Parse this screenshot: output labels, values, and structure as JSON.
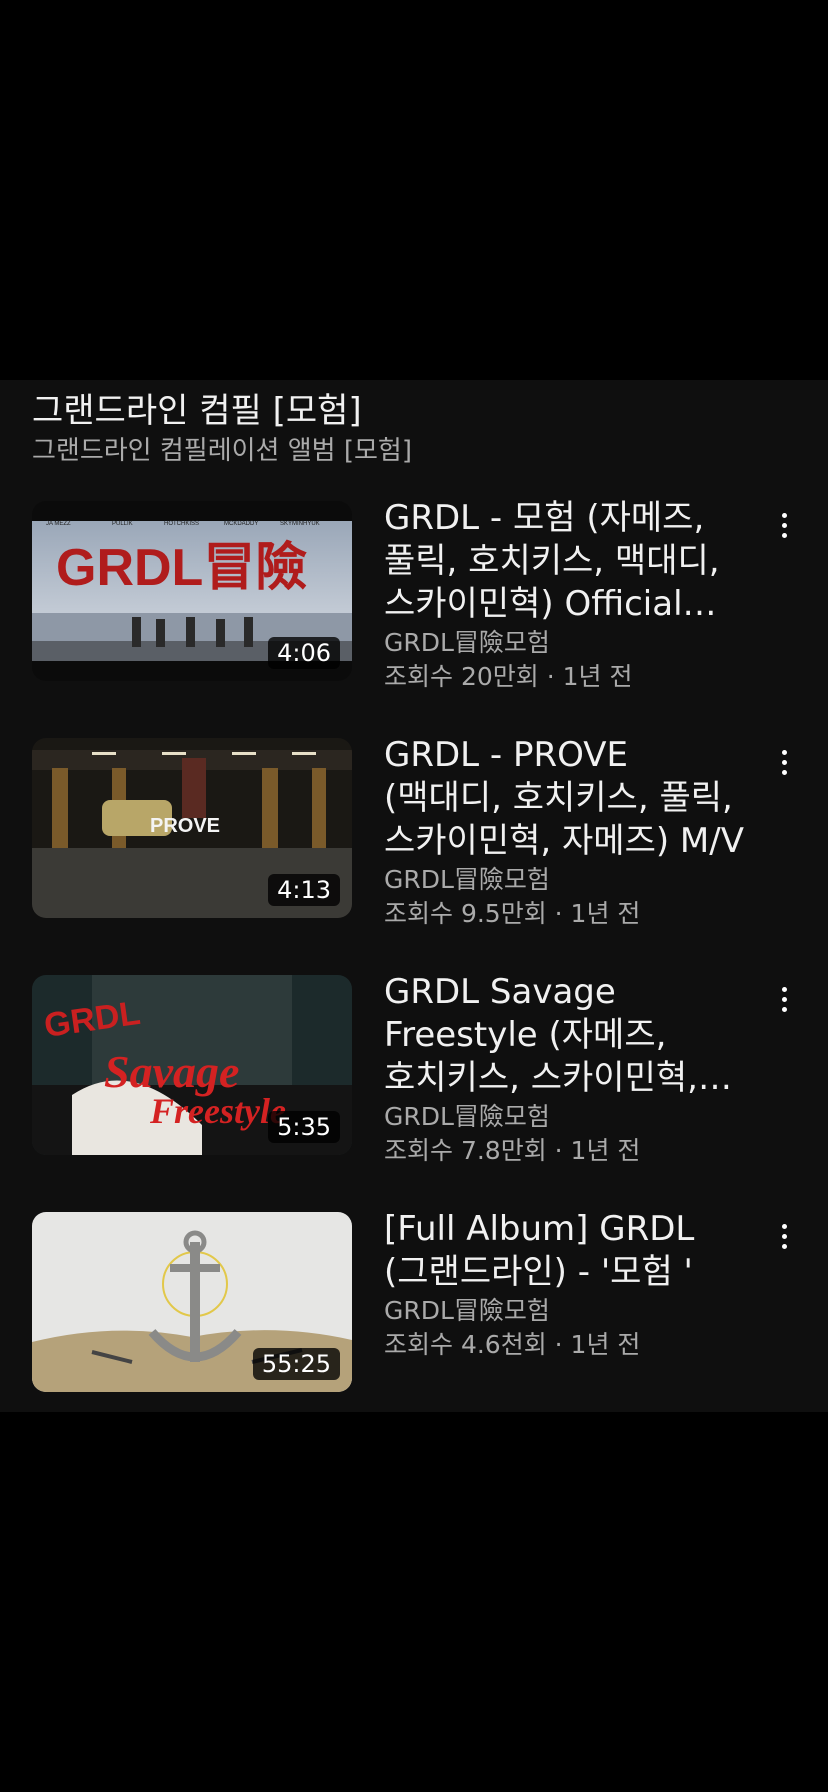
{
  "playlist": {
    "title": "그랜드라인 컴필 [모험]",
    "subtitle": "그랜드라인 컴필레이션 앨범 [모험]"
  },
  "videos": [
    {
      "title": "GRDL - 모험 (자메즈, 풀릭, 호치키스, 맥대디, 스카이민혁) Official V...",
      "duration": "4:06",
      "channel": "GRDL冒險모험",
      "stats": "조회수 20만회 · 1년 전",
      "thumb_text": "GRDL冒險",
      "thumb_names": [
        "JA MEZZ",
        "PULLIK",
        "HOTCHKISS",
        "MCKDADDY",
        "SKYMINHYUK"
      ]
    },
    {
      "title": "GRDL - PROVE (맥대디, 호치키스, 풀릭, 스카이민혁, 자메즈) M/V",
      "duration": "4:13",
      "channel": "GRDL冒險모험",
      "stats": "조회수 9.5만회 · 1년 전",
      "thumb_text": "PROVE"
    },
    {
      "title": "GRDL Savage Freestyle (자메즈, 호치키스, 스카이민혁, 풀릭...",
      "duration": "5:35",
      "channel": "GRDL冒險모험",
      "stats": "조회수 7.8만회 · 1년 전",
      "thumb_text": [
        "GRDL",
        "Savage",
        "Freestyle"
      ]
    },
    {
      "title": "[Full Album] GRDL (그랜드라인) - '모험 '",
      "duration": "55:25",
      "channel": "GRDL冒險모험",
      "stats": "조회수 4.6천회 · 1년 전"
    }
  ]
}
